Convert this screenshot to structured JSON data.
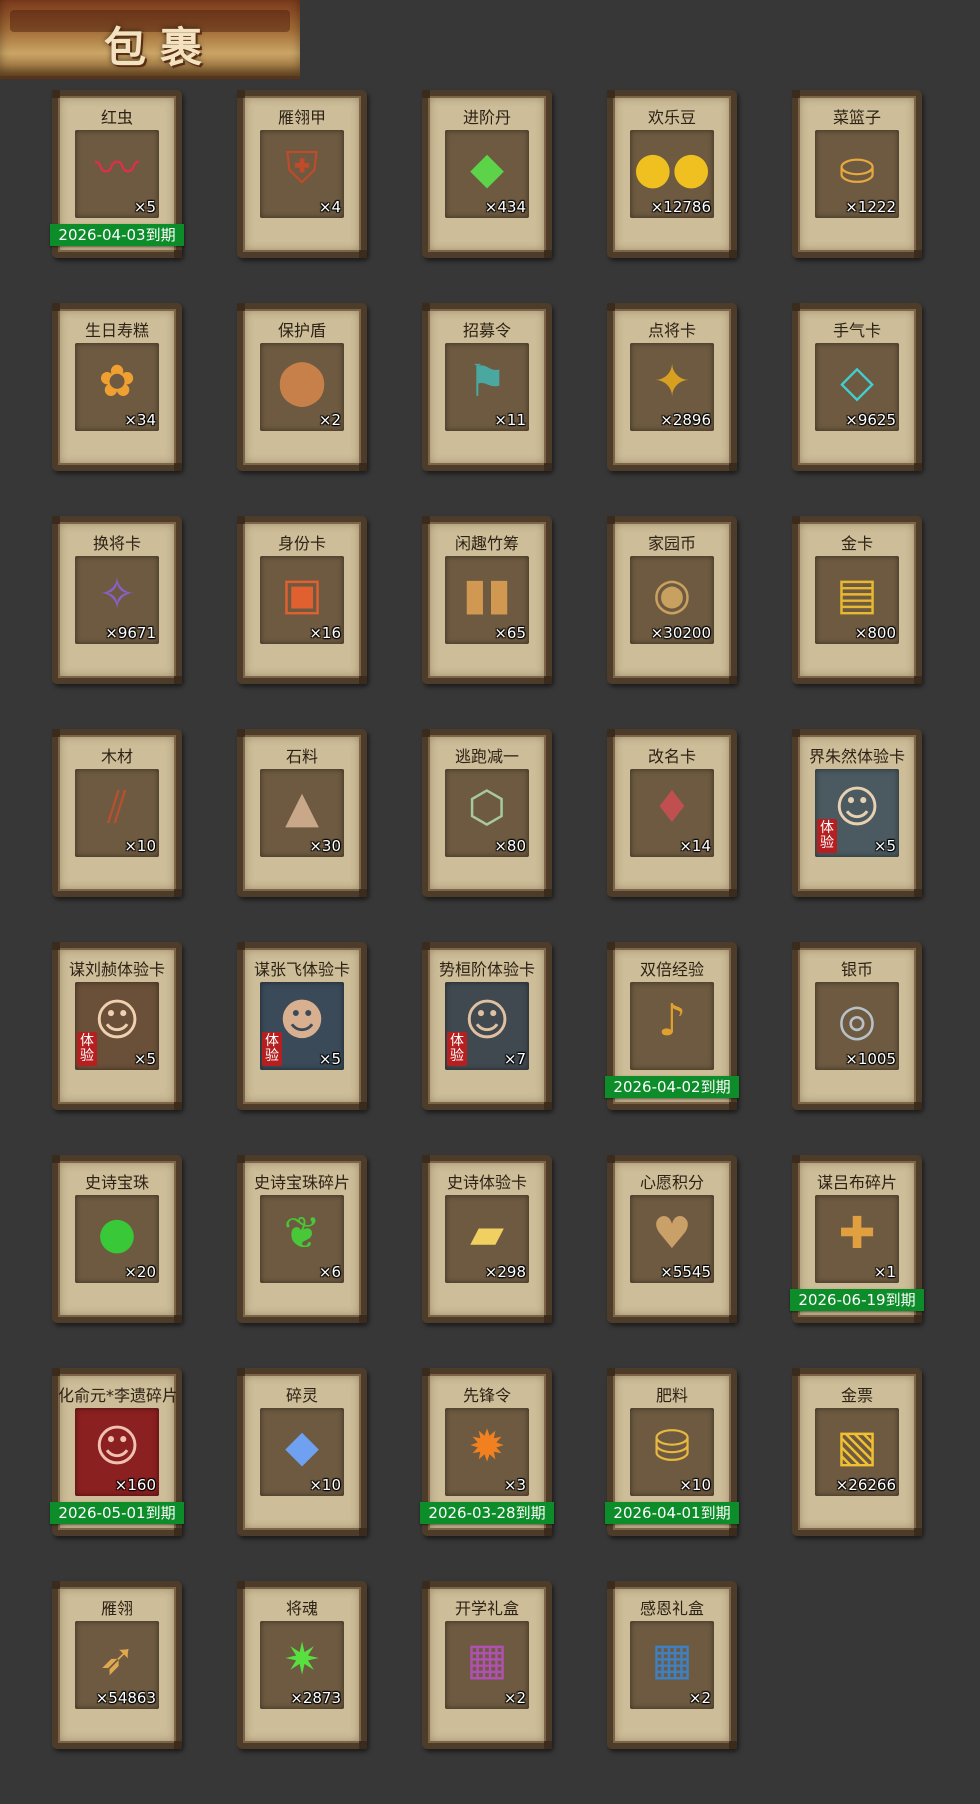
{
  "title": "包裹",
  "items": [
    {
      "name": "红虫",
      "count": "×5",
      "expire": "2026-04-03到期",
      "trial": "",
      "icon": "red-worm-icon",
      "glyph": "〰",
      "color": "#d8324a",
      "bg": "#6d5a40"
    },
    {
      "name": "雁翎甲",
      "count": "×4",
      "expire": "",
      "trial": "",
      "icon": "armor-icon",
      "glyph": "⛨",
      "color": "#c04a2a",
      "bg": "#6d5a40"
    },
    {
      "name": "进阶丹",
      "count": "×434",
      "expire": "",
      "trial": "",
      "icon": "green-pill-icon",
      "glyph": "◆",
      "color": "#5dd34a",
      "bg": "#6d5a40"
    },
    {
      "name": "欢乐豆",
      "count": "×12786",
      "expire": "",
      "trial": "",
      "icon": "gold-bean-icon",
      "glyph": "●●",
      "color": "#f0c020",
      "bg": "#6d5a40"
    },
    {
      "name": "菜篮子",
      "count": "×1222",
      "expire": "",
      "trial": "",
      "icon": "basket-icon",
      "glyph": "⛀",
      "color": "#e8a840",
      "bg": "#6d5a40"
    },
    {
      "name": "生日寿糕",
      "count": "×34",
      "expire": "",
      "trial": "",
      "icon": "birthday-cake-icon",
      "glyph": "✿",
      "color": "#f0a030",
      "bg": "#6d5a40"
    },
    {
      "name": "保护盾",
      "count": "×2",
      "expire": "",
      "trial": "",
      "icon": "shield-icon",
      "glyph": "⬤",
      "color": "#c8804a",
      "bg": "#6d5a40"
    },
    {
      "name": "招募令",
      "count": "×11",
      "expire": "",
      "trial": "",
      "icon": "recruit-token-icon",
      "glyph": "⚑",
      "color": "#4aa8a0",
      "bg": "#6d5a40"
    },
    {
      "name": "点将卡",
      "count": "×2896",
      "expire": "",
      "trial": "",
      "icon": "general-card-icon",
      "glyph": "✦",
      "color": "#d8a020",
      "bg": "#6d5a40"
    },
    {
      "name": "手气卡",
      "count": "×9625",
      "expire": "",
      "trial": "",
      "icon": "luck-card-icon",
      "glyph": "◇",
      "color": "#40d0d0",
      "bg": "#6d5a40"
    },
    {
      "name": "换将卡",
      "count": "×9671",
      "expire": "",
      "trial": "",
      "icon": "swap-card-icon",
      "glyph": "✧",
      "color": "#8a60c8",
      "bg": "#6d5a40"
    },
    {
      "name": "身份卡",
      "count": "×16",
      "expire": "",
      "trial": "",
      "icon": "identity-card-icon",
      "glyph": "▣",
      "color": "#e06030",
      "bg": "#6d5a40"
    },
    {
      "name": "闲趣竹筹",
      "count": "×65",
      "expire": "",
      "trial": "",
      "icon": "bamboo-token-icon",
      "glyph": "▮▮",
      "color": "#d09850",
      "bg": "#6d5a40"
    },
    {
      "name": "家园币",
      "count": "×30200",
      "expire": "",
      "trial": "",
      "icon": "home-coin-icon",
      "glyph": "◉",
      "color": "#c8a060",
      "bg": "#6d5a40"
    },
    {
      "name": "金卡",
      "count": "×800",
      "expire": "",
      "trial": "",
      "icon": "gold-card-icon",
      "glyph": "▤",
      "color": "#e8b830",
      "bg": "#6d5a40"
    },
    {
      "name": "木材",
      "count": "×10",
      "expire": "",
      "trial": "",
      "icon": "wood-icon",
      "glyph": "⫽",
      "color": "#b85030",
      "bg": "#6d5a40"
    },
    {
      "name": "石料",
      "count": "×30",
      "expire": "",
      "trial": "",
      "icon": "stone-icon",
      "glyph": "▲",
      "color": "#c8a888",
      "bg": "#6d5a40"
    },
    {
      "name": "逃跑减一",
      "count": "×80",
      "expire": "",
      "trial": "",
      "icon": "jade-tag-icon",
      "glyph": "⬡",
      "color": "#a8c8a0",
      "bg": "#6d5a40"
    },
    {
      "name": "改名卡",
      "count": "×14",
      "expire": "",
      "trial": "",
      "icon": "rename-card-icon",
      "glyph": "♦",
      "color": "#c05050",
      "bg": "#6d5a40"
    },
    {
      "name": "界朱然体验卡",
      "count": "×5",
      "expire": "",
      "trial": "体验",
      "icon": "hero-portrait-icon",
      "glyph": "☺",
      "color": "#e8d0b0",
      "bg": "#4a5a60"
    },
    {
      "name": "谋刘赪体验卡",
      "count": "×5",
      "expire": "",
      "trial": "体验",
      "icon": "hero-portrait-icon",
      "glyph": "☺",
      "color": "#f0d0b0",
      "bg": "#6a5038"
    },
    {
      "name": "谋张飞体验卡",
      "count": "×5",
      "expire": "",
      "trial": "体验",
      "icon": "hero-portrait-icon",
      "glyph": "☻",
      "color": "#d8b090",
      "bg": "#3a4a58"
    },
    {
      "name": "势桓阶体验卡",
      "count": "×7",
      "expire": "",
      "trial": "体验",
      "icon": "hero-portrait-icon",
      "glyph": "☺",
      "color": "#e0c0a0",
      "bg": "#404850"
    },
    {
      "name": "双倍经验",
      "count": "",
      "expire": "2026-04-02到期",
      "trial": "",
      "icon": "ruyi-scepter-icon",
      "glyph": "♪",
      "color": "#e0a030",
      "bg": "#6d5a40"
    },
    {
      "name": "银币",
      "count": "×1005",
      "expire": "",
      "trial": "",
      "icon": "silver-coin-icon",
      "glyph": "◎",
      "color": "#b8c0c8",
      "bg": "#6d5a40"
    },
    {
      "name": "史诗宝珠",
      "count": "×20",
      "expire": "",
      "trial": "",
      "icon": "green-orb-icon",
      "glyph": "●",
      "color": "#38c838",
      "bg": "#6d5a40"
    },
    {
      "name": "史诗宝珠碎片",
      "count": "×6",
      "expire": "",
      "trial": "",
      "icon": "orb-fragment-icon",
      "glyph": "❦",
      "color": "#48c838",
      "bg": "#6d5a40"
    },
    {
      "name": "史诗体验卡",
      "count": "×298",
      "expire": "",
      "trial": "",
      "icon": "gold-ticket-icon",
      "glyph": "▰",
      "color": "#f0d060",
      "bg": "#6d5a40"
    },
    {
      "name": "心愿积分",
      "count": "×5545",
      "expire": "",
      "trial": "",
      "icon": "heart-coin-icon",
      "glyph": "♥",
      "color": "#c8a068",
      "bg": "#6d5a40"
    },
    {
      "name": "谋吕布碎片",
      "count": "×1",
      "expire": "2026-06-19到期",
      "trial": "",
      "icon": "hero-fragment-icon",
      "glyph": "✚",
      "color": "#e0a040",
      "bg": "#6d5a40"
    },
    {
      "name": "化俞元*李遗碎片",
      "count": "×160",
      "expire": "2026-05-01到期",
      "trial": "",
      "icon": "hero-portrait-icon",
      "glyph": "☺",
      "color": "#f0c0b0",
      "bg": "#8a2020"
    },
    {
      "name": "碎灵",
      "count": "×10",
      "expire": "",
      "trial": "",
      "icon": "blue-crystal-icon",
      "glyph": "◆",
      "color": "#70a0f0",
      "bg": "#6d5a40"
    },
    {
      "name": "先锋令",
      "count": "×3",
      "expire": "2026-03-28到期",
      "trial": "",
      "icon": "vanguard-token-icon",
      "glyph": "✹",
      "color": "#f08020",
      "bg": "#6d5a40"
    },
    {
      "name": "肥料",
      "count": "×10",
      "expire": "2026-04-01到期",
      "trial": "",
      "icon": "fertilizer-bag-icon",
      "glyph": "⛁",
      "color": "#e8b840",
      "bg": "#6d5a40"
    },
    {
      "name": "金票",
      "count": "×26266",
      "expire": "",
      "trial": "",
      "icon": "gold-scroll-icon",
      "glyph": "▧",
      "color": "#f0c030",
      "bg": "#6d5a40"
    },
    {
      "name": "雁翎",
      "count": "×54863",
      "expire": "",
      "trial": "",
      "icon": "feather-icon",
      "glyph": "➶",
      "color": "#e0a850",
      "bg": "#6d5a40"
    },
    {
      "name": "将魂",
      "count": "×2873",
      "expire": "",
      "trial": "",
      "icon": "green-soul-icon",
      "glyph": "✷",
      "color": "#58e040",
      "bg": "#6d5a40"
    },
    {
      "name": "开学礼盒",
      "count": "×2",
      "expire": "",
      "trial": "",
      "icon": "purple-giftbox-icon",
      "glyph": "▦",
      "color": "#b050b0",
      "bg": "#6d5a40"
    },
    {
      "name": "感恩礼盒",
      "count": "×2",
      "expire": "",
      "trial": "",
      "icon": "blue-giftbox-icon",
      "glyph": "▦",
      "color": "#4080c0",
      "bg": "#6d5a40"
    }
  ]
}
